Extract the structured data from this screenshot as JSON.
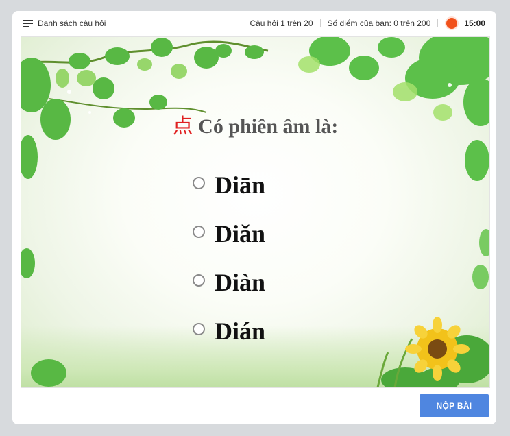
{
  "topbar": {
    "question_list_label": "Danh sách câu hỏi",
    "question_progress": "Câu hỏi 1 trên 20",
    "score": "Số điểm của bạn: 0 trên 200",
    "timer": "15:00"
  },
  "question": {
    "character": "点",
    "prompt": "Có phiên âm là:"
  },
  "options": [
    {
      "label": "Diān"
    },
    {
      "label": "Diǎn"
    },
    {
      "label": "Diàn"
    },
    {
      "label": "Dián"
    }
  ],
  "submit_label": "NỘP BÀI",
  "colors": {
    "accent": "#4f86e0",
    "timer_dot": "#f1511b",
    "character": "#e02020"
  }
}
